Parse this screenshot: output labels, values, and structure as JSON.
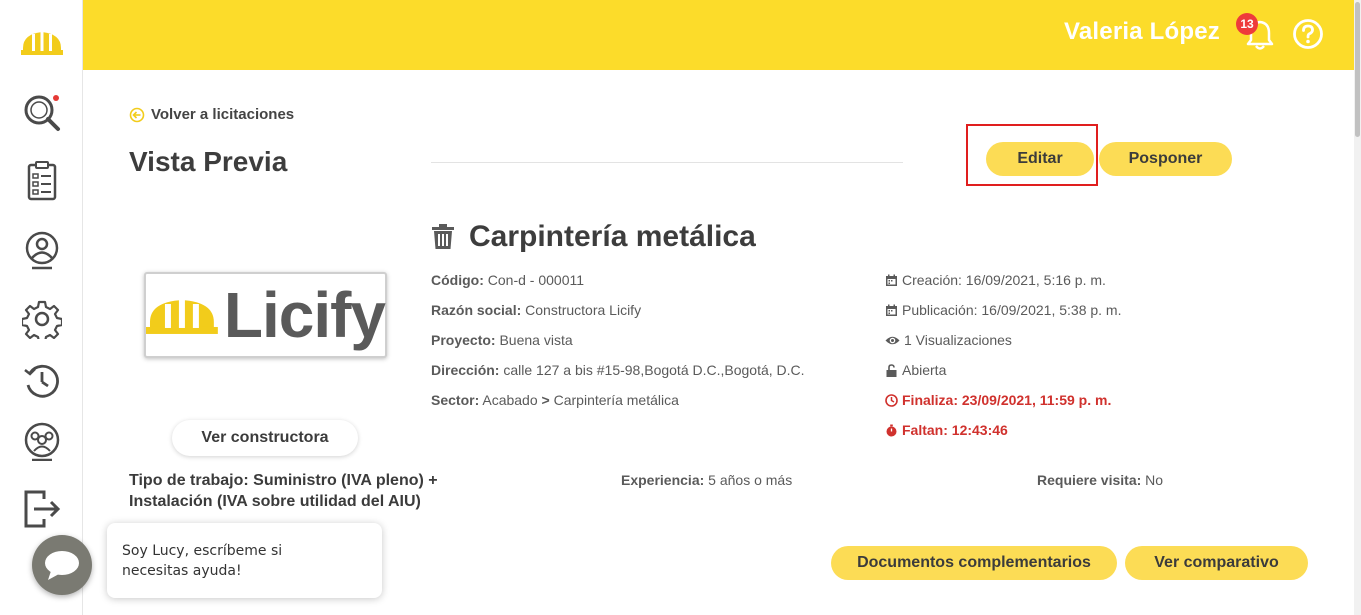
{
  "header": {
    "user_name": "Valeria López",
    "notification_count": "13"
  },
  "sidebar": {
    "items": [
      {
        "icon": "search-icon"
      },
      {
        "icon": "checklist-icon"
      },
      {
        "icon": "user-icon"
      },
      {
        "icon": "gear-icon"
      },
      {
        "icon": "history-icon"
      },
      {
        "icon": "team-icon"
      },
      {
        "icon": "logout-icon"
      }
    ]
  },
  "page": {
    "back_label": "Volver a licitaciones",
    "title": "Vista Previa",
    "edit_button": "Editar",
    "postpone_button": "Posponer"
  },
  "company": {
    "logo_text": "Licify",
    "view_button": "Ver constructora"
  },
  "project": {
    "name": "Carpintería metálica",
    "codigo_label": "Código:",
    "codigo_value": "Con-d - 000011",
    "razon_label": "Razón social:",
    "razon_value": "Constructora Licify",
    "proyecto_label": "Proyecto:",
    "proyecto_value": "Buena vista",
    "direccion_label": "Dirección:",
    "direccion_value": "calle 127 a bis #15-98,Bogotá D.C.,Bogotá, D.C.",
    "sector_label": "Sector:",
    "sector_value": "Acabado",
    "sector_separator": ">",
    "sector_sub": "Carpintería metálica"
  },
  "meta": {
    "creacion": "Creación: 16/09/2021, 5:16 p. m.",
    "publicacion": "Publicación: 16/09/2021, 5:38 p. m.",
    "visualizaciones": "1 Visualizaciones",
    "estado": "Abierta",
    "finaliza": "Finaliza: 23/09/2021, 11:59 p. m.",
    "faltan": "Faltan: 12:43:46"
  },
  "details": {
    "tipo_line1": "Tipo de trabajo: Suministro (IVA pleno) +",
    "tipo_line2": "Instalación (IVA sobre utilidad del AIU)",
    "experiencia_label": "Experiencia:",
    "experiencia_value": "5 años o más",
    "visita_label": "Requiere visita:",
    "visita_value": "No"
  },
  "actions": {
    "documentos": "Documentos complementarios",
    "comparativo": "Ver comparativo"
  },
  "chat": {
    "message_line1": "Soy Lucy, escríbeme si",
    "message_line2": "necesitas ayuda!"
  },
  "colors": {
    "brand_yellow": "#fcdc2a",
    "pill_yellow": "#fcdc55",
    "alert_red": "#d0312d"
  }
}
